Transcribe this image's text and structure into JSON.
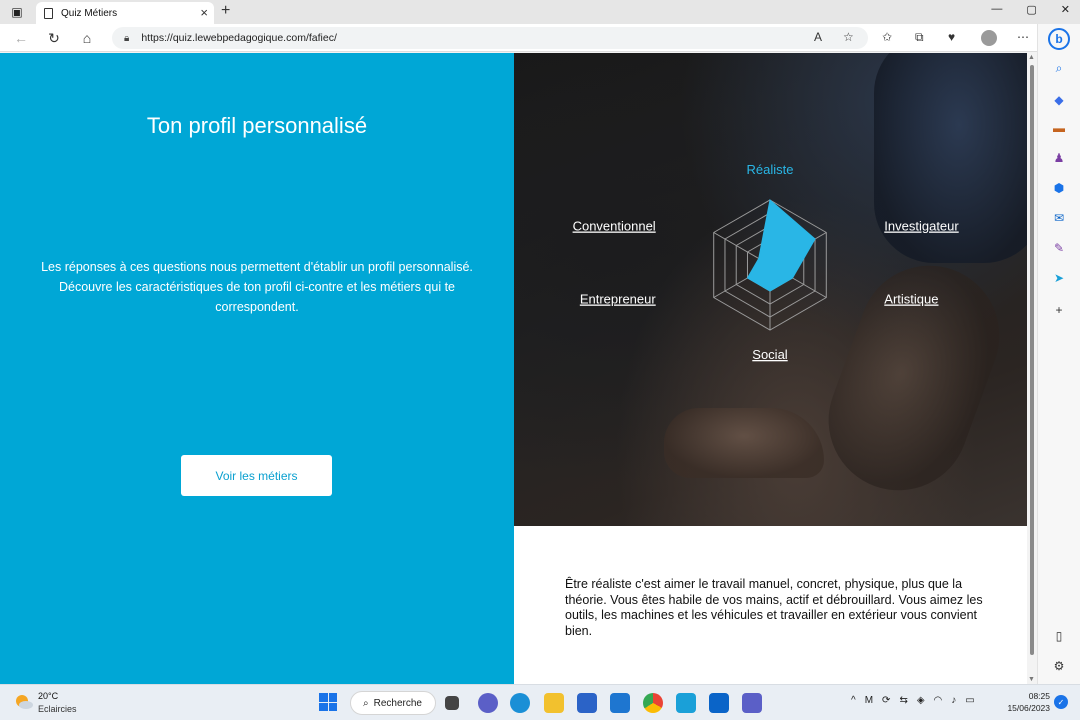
{
  "browser": {
    "tab_title": "Quiz Métiers",
    "url": "https://quiz.lewebpedagogique.com/fafiec/",
    "window_controls": [
      "—",
      "▢",
      "✕"
    ]
  },
  "page": {
    "title": "Ton profil personnalisé",
    "description_line1": "Les réponses à ces questions nous permettent d'établir un profil personnalisé.",
    "description_line2": "Découvre les caractéristiques de ton profil ci-contre et les métiers qui te correspondent.",
    "button_label": "Voir les métiers",
    "profile_description": "Être réaliste c'est aimer le travail manuel, concret, physique, plus que la théorie. Vous êtes habile de vos mains, actif et débrouillard. Vous aimez les outils, les machines et les véhicules et travailler en extérieur vous convient bien.",
    "accent_color": "#00a7d6"
  },
  "chart_data": {
    "type": "radar",
    "axes": [
      "Réaliste",
      "Investigateur",
      "Artistique",
      "Social",
      "Entrepreneur",
      "Conventionnel"
    ],
    "active_axis": "Réaliste",
    "rings": 5,
    "values": [
      5,
      4,
      2,
      2,
      2,
      1
    ],
    "max": 5,
    "fill_color": "#29b6e6"
  },
  "taskbar": {
    "weather_temp": "20°C",
    "weather_desc": "Eclaircies",
    "search_label": "Recherche",
    "time": "08:25",
    "date": "15/06/2023"
  }
}
